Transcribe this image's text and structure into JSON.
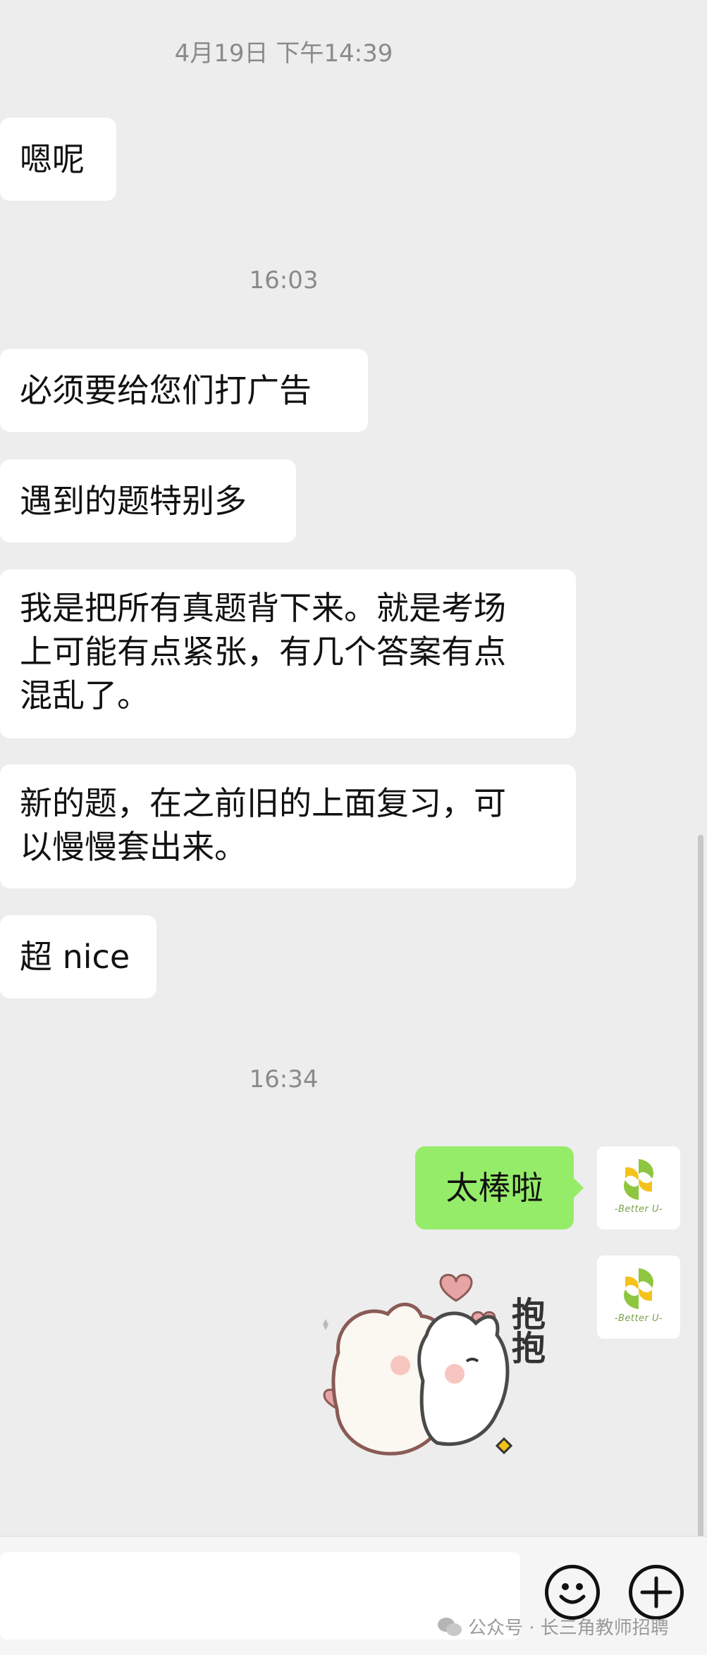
{
  "timestamps": [
    "4月19日 下午14:39",
    "16:03",
    "16:34"
  ],
  "messages_in": [
    {
      "lines": [
        "嗯呢"
      ]
    },
    {
      "lines": [
        "必须要给您们打广告"
      ]
    },
    {
      "lines": [
        "遇到的题特别多"
      ]
    },
    {
      "lines": [
        "我是把所有真题背下来。就是考场",
        "上可能有点紧张，有几个答案有点",
        "混乱了。"
      ]
    },
    {
      "lines": [
        "新的题，在之前旧的上面复习，可",
        "以慢慢套出来。"
      ]
    },
    {
      "lines": [
        "超 nice"
      ]
    }
  ],
  "messages_out": [
    {
      "text": "太棒啦"
    }
  ],
  "sticker": {
    "text": "抱抱",
    "icon": "hug-bear-sticker"
  },
  "avatar": {
    "label": "-Better U-",
    "icon": "better-u-logo-icon",
    "colors": [
      "#8ec63f",
      "#f4c21b"
    ]
  },
  "input_bar": {
    "emoji_icon": "emoji-icon",
    "plus_icon": "plus-icon"
  },
  "watermark": {
    "text": "公众号 · 长三角教师招聘",
    "icon": "wechat-official-account-icon"
  },
  "colors": {
    "background": "#ededed",
    "incoming_bubble": "#ffffff",
    "outgoing_bubble": "#95ec69"
  }
}
